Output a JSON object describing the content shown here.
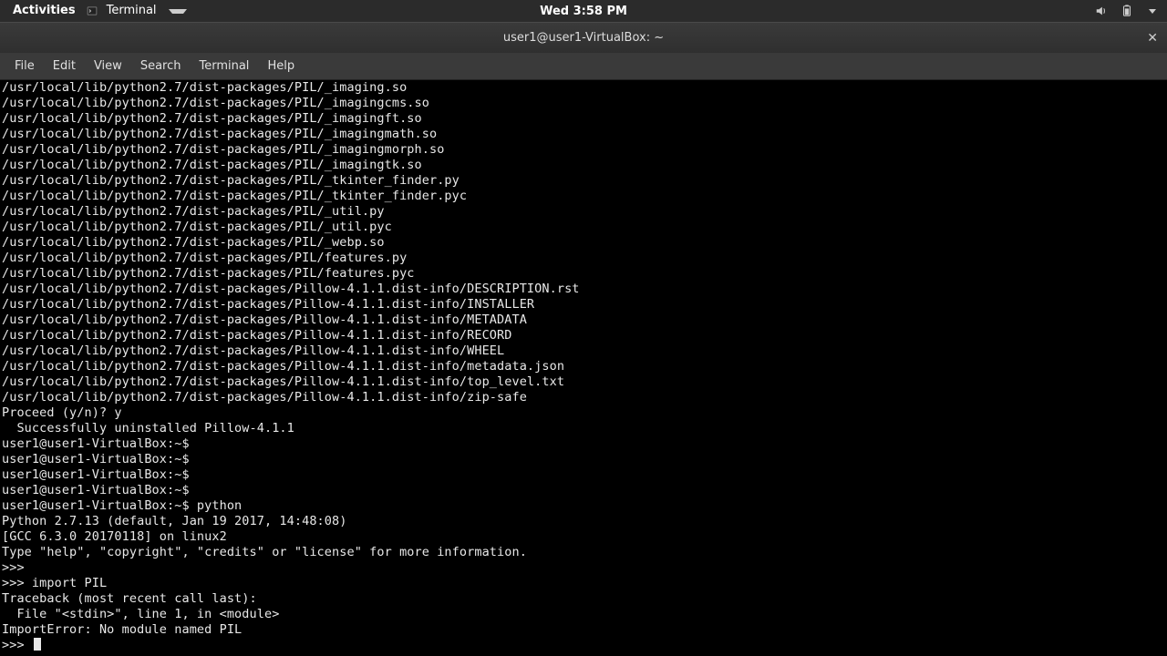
{
  "topbar": {
    "activities": "Activities",
    "app_label": "Terminal",
    "clock": "Wed  3:58 PM"
  },
  "window": {
    "title": "user1@user1-VirtualBox: ~"
  },
  "menu": {
    "file": "File",
    "edit": "Edit",
    "view": "View",
    "search": "Search",
    "terminal": "Terminal",
    "help": "Help"
  },
  "terminal_lines": [
    "/usr/local/lib/python2.7/dist-packages/PIL/_imaging.so",
    "/usr/local/lib/python2.7/dist-packages/PIL/_imagingcms.so",
    "/usr/local/lib/python2.7/dist-packages/PIL/_imagingft.so",
    "/usr/local/lib/python2.7/dist-packages/PIL/_imagingmath.so",
    "/usr/local/lib/python2.7/dist-packages/PIL/_imagingmorph.so",
    "/usr/local/lib/python2.7/dist-packages/PIL/_imagingtk.so",
    "/usr/local/lib/python2.7/dist-packages/PIL/_tkinter_finder.py",
    "/usr/local/lib/python2.7/dist-packages/PIL/_tkinter_finder.pyc",
    "/usr/local/lib/python2.7/dist-packages/PIL/_util.py",
    "/usr/local/lib/python2.7/dist-packages/PIL/_util.pyc",
    "/usr/local/lib/python2.7/dist-packages/PIL/_webp.so",
    "/usr/local/lib/python2.7/dist-packages/PIL/features.py",
    "/usr/local/lib/python2.7/dist-packages/PIL/features.pyc",
    "/usr/local/lib/python2.7/dist-packages/Pillow-4.1.1.dist-info/DESCRIPTION.rst",
    "/usr/local/lib/python2.7/dist-packages/Pillow-4.1.1.dist-info/INSTALLER",
    "/usr/local/lib/python2.7/dist-packages/Pillow-4.1.1.dist-info/METADATA",
    "/usr/local/lib/python2.7/dist-packages/Pillow-4.1.1.dist-info/RECORD",
    "/usr/local/lib/python2.7/dist-packages/Pillow-4.1.1.dist-info/WHEEL",
    "/usr/local/lib/python2.7/dist-packages/Pillow-4.1.1.dist-info/metadata.json",
    "/usr/local/lib/python2.7/dist-packages/Pillow-4.1.1.dist-info/top_level.txt",
    "/usr/local/lib/python2.7/dist-packages/Pillow-4.1.1.dist-info/zip-safe",
    "Proceed (y/n)? y",
    "  Successfully uninstalled Pillow-4.1.1",
    "user1@user1-VirtualBox:~$ ",
    "user1@user1-VirtualBox:~$ ",
    "user1@user1-VirtualBox:~$ ",
    "user1@user1-VirtualBox:~$ ",
    "user1@user1-VirtualBox:~$ python",
    "Python 2.7.13 (default, Jan 19 2017, 14:48:08) ",
    "[GCC 6.3.0 20170118] on linux2",
    "Type \"help\", \"copyright\", \"credits\" or \"license\" for more information.",
    ">>> ",
    ">>> import PIL",
    "Traceback (most recent call last):",
    "  File \"<stdin>\", line 1, in <module>",
    "ImportError: No module named PIL"
  ],
  "prompt_last": ">>> "
}
